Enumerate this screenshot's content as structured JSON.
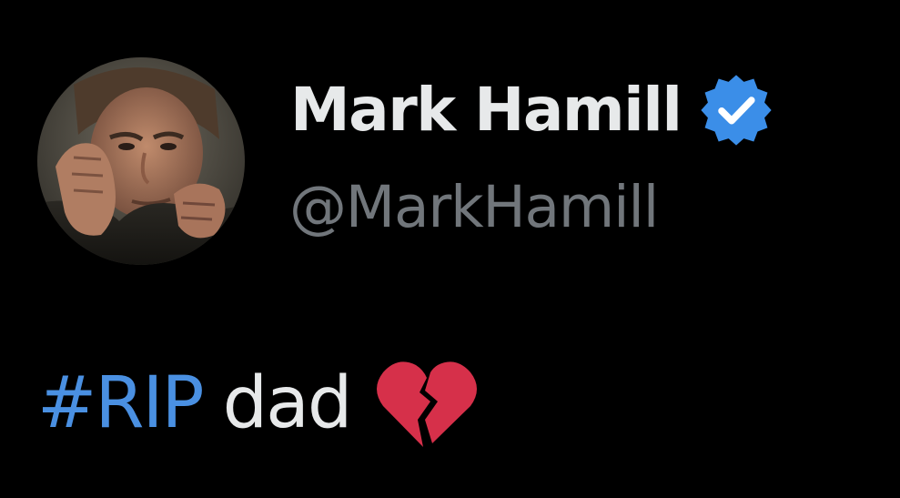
{
  "author": {
    "display_name": "Mark Hamill",
    "handle": "@MarkHamill",
    "verified": true,
    "verified_badge_color": "#3b8ee8",
    "avatar_icon": "profile-photo"
  },
  "tweet": {
    "hashtag": "#RIP",
    "body": "dad",
    "emoji": "broken-heart-icon",
    "hashtag_color": "#4a90e2",
    "text_color": "#e7e9ea"
  },
  "theme": {
    "background": "#000000",
    "secondary_text": "#71767b"
  }
}
